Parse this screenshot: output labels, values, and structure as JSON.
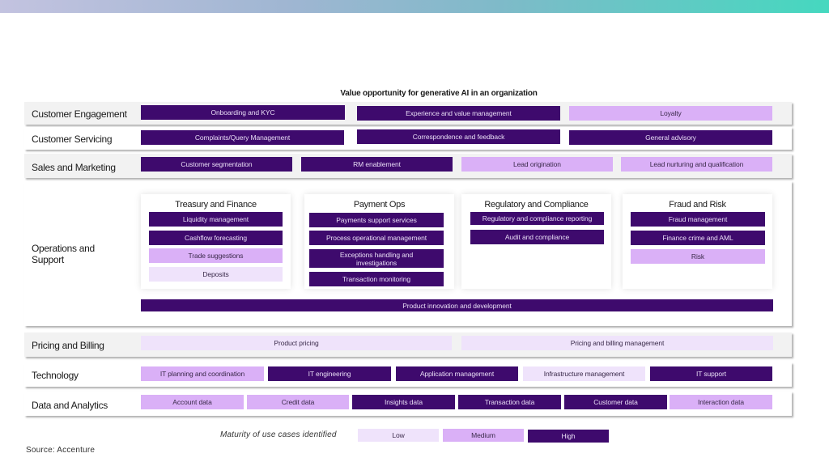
{
  "title": "Value opportunity for generative AI in an organization",
  "colors": {
    "high": "#3e0a6d",
    "medium": "#dab0f7",
    "low": "#efe3fb"
  },
  "rows": {
    "customer_engagement": {
      "label": "Customer Engagement",
      "items": [
        {
          "label": "Onboarding and KYC",
          "maturity": "high"
        },
        {
          "label": "Experience and value management",
          "maturity": "high"
        },
        {
          "label": "Loyalty",
          "maturity": "medium"
        }
      ]
    },
    "customer_servicing": {
      "label": "Customer Servicing",
      "items": [
        {
          "label": "Complaints/Query Management",
          "maturity": "high"
        },
        {
          "label": "Correspondence and feedback",
          "maturity": "high"
        },
        {
          "label": "General advisory",
          "maturity": "high"
        }
      ]
    },
    "sales_marketing": {
      "label": "Sales and Marketing",
      "items": [
        {
          "label": "Customer segmentation",
          "maturity": "high"
        },
        {
          "label": "RM enablement",
          "maturity": "high"
        },
        {
          "label": "Lead origination",
          "maturity": "medium"
        },
        {
          "label": "Lead nurturing and qualification",
          "maturity": "medium"
        }
      ]
    },
    "operations_support": {
      "label": "Operations and Support",
      "cards": [
        {
          "title": "Treasury and Finance",
          "items": [
            {
              "label": "Liquidity management",
              "maturity": "high"
            },
            {
              "label": "Cashflow forecasting",
              "maturity": "high"
            },
            {
              "label": "Trade suggestions",
              "maturity": "medium"
            },
            {
              "label": "Deposits",
              "maturity": "low"
            }
          ]
        },
        {
          "title": "Payment Ops",
          "items": [
            {
              "label": "Payments support services",
              "maturity": "high"
            },
            {
              "label": "Process operational management",
              "maturity": "high"
            },
            {
              "label": "Exceptions handling and investigations",
              "maturity": "high"
            },
            {
              "label": "Transaction monitoring",
              "maturity": "high"
            }
          ]
        },
        {
          "title": "Regulatory and Compliance",
          "items": [
            {
              "label": "Regulatory and compliance reporting",
              "maturity": "high"
            },
            {
              "label": "Audit and compliance",
              "maturity": "high"
            }
          ]
        },
        {
          "title": "Fraud and Risk",
          "items": [
            {
              "label": "Fraud management",
              "maturity": "high"
            },
            {
              "label": "Finance crime and AML",
              "maturity": "high"
            },
            {
              "label": "Risk",
              "maturity": "medium"
            }
          ]
        }
      ],
      "wide_item": {
        "label": "Product innovation and development",
        "maturity": "high"
      }
    },
    "pricing_billing": {
      "label": "Pricing and Billing",
      "items": [
        {
          "label": "Product pricing",
          "maturity": "low"
        },
        {
          "label": "Pricing and billing management",
          "maturity": "low"
        }
      ]
    },
    "technology": {
      "label": "Technology",
      "items": [
        {
          "label": "IT planning and coordination",
          "maturity": "medium"
        },
        {
          "label": "IT engineering",
          "maturity": "high"
        },
        {
          "label": "Application management",
          "maturity": "high"
        },
        {
          "label": "Infrastructure management",
          "maturity": "low"
        },
        {
          "label": "IT support",
          "maturity": "high"
        }
      ]
    },
    "data_analytics": {
      "label": "Data and Analytics",
      "items": [
        {
          "label": "Account data",
          "maturity": "medium"
        },
        {
          "label": "Credit data",
          "maturity": "medium"
        },
        {
          "label": "Insights data",
          "maturity": "high"
        },
        {
          "label": "Transaction data",
          "maturity": "high"
        },
        {
          "label": "Customer data",
          "maturity": "high"
        },
        {
          "label": "Interaction data",
          "maturity": "medium"
        }
      ]
    }
  },
  "legend": {
    "label": "Maturity of use cases identified",
    "low": "Low",
    "medium": "Medium",
    "high": "High"
  },
  "source": "Source: Accenture"
}
